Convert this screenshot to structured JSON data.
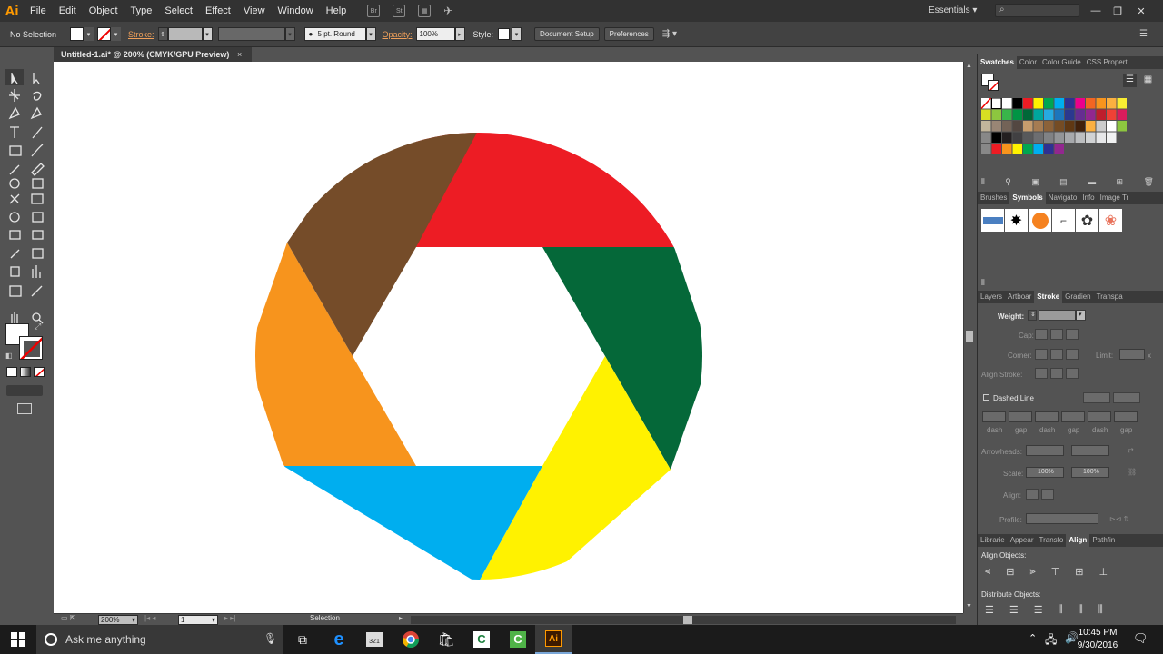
{
  "menu": {
    "logo": "Ai",
    "items": [
      "File",
      "Edit",
      "Object",
      "Type",
      "Select",
      "Effect",
      "View",
      "Window",
      "Help"
    ],
    "workspace": "Essentials"
  },
  "control_bar": {
    "selection": "No Selection",
    "stroke_label": "Stroke:",
    "brush": "5 pt. Round",
    "opacity_label": "Opacity:",
    "opacity_value": "100%",
    "style_label": "Style:",
    "document_setup": "Document Setup",
    "preferences": "Preferences"
  },
  "document": {
    "tab_title": "Untitled-1.ai* @ 200% (CMYK/GPU Preview)",
    "close": "×"
  },
  "artwork": {
    "description_colors": {
      "red": "#ED1C24",
      "green": "#056839",
      "yellow": "#FFF200",
      "blue": "#00AEEF",
      "orange": "#F7941D",
      "brown": "#754C29"
    }
  },
  "status": {
    "zoom": "200%",
    "artboard": "1",
    "mode": "Selection"
  },
  "panels": {
    "swatches_tabs": [
      "Swatches",
      "Color",
      "Color Guide",
      "CSS Propert"
    ],
    "symbols_tabs": [
      "Brushes",
      "Symbols",
      "Navigato",
      "Info",
      "Image Tr"
    ],
    "stroke_tabs": [
      "Layers",
      "Artboar",
      "Stroke",
      "Gradien",
      "Transpa"
    ],
    "stroke": {
      "weight": "Weight:",
      "cap": "Cap:",
      "corner": "Corner:",
      "limit": "Limit:",
      "limit_x": "x",
      "align_stroke": "Align Stroke:",
      "dashed_line": "Dashed Line",
      "dash_labels": [
        "dash",
        "gap",
        "dash",
        "gap",
        "dash",
        "gap"
      ],
      "arrowheads": "Arrowheads:",
      "scale": "Scale:",
      "scale_a": "100%",
      "scale_b": "100%",
      "align": "Align:",
      "profile": "Profile:"
    },
    "align_tabs": [
      "Librarie",
      "Appear",
      "Transfo",
      "Align",
      "Pathfin"
    ],
    "align": {
      "objects": "Align Objects:",
      "distribute": "Distribute Objects:"
    }
  },
  "taskbar": {
    "search_placeholder": "Ask me anything",
    "time": "10:45 PM",
    "date": "9/30/2016"
  }
}
